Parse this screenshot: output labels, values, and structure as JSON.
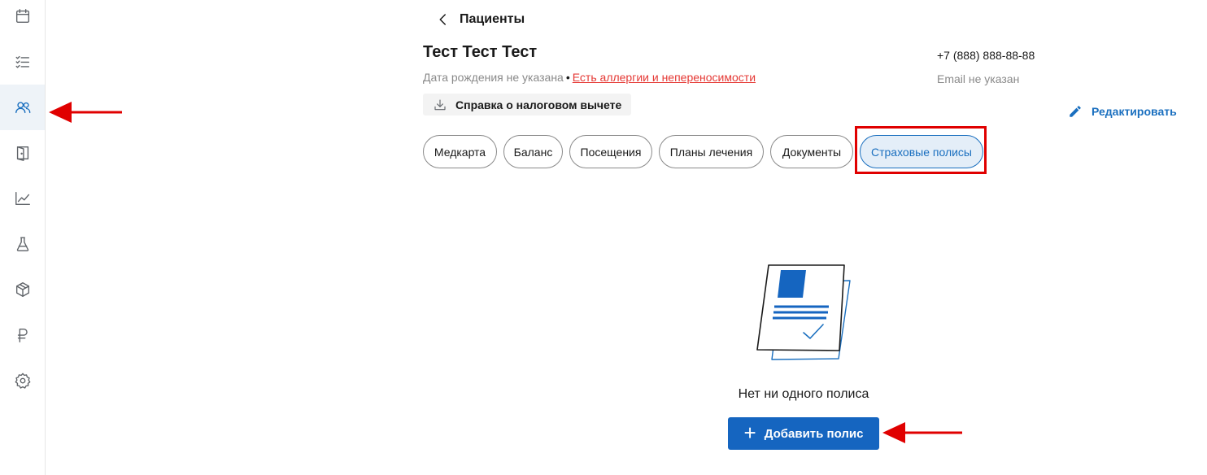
{
  "sidebar": {
    "items": [
      {
        "icon": "calendar-icon",
        "active": false
      },
      {
        "icon": "task-list-icon",
        "active": false
      },
      {
        "icon": "users-icon",
        "active": true
      },
      {
        "icon": "door-icon",
        "active": false
      },
      {
        "icon": "chart-line-icon",
        "active": false
      },
      {
        "icon": "flask-icon",
        "active": false
      },
      {
        "icon": "box-icon",
        "active": false
      },
      {
        "icon": "ruble-icon",
        "active": false
      },
      {
        "icon": "gear-icon",
        "active": false
      }
    ]
  },
  "header": {
    "back_label": "Пациенты",
    "patient_name": "Тест Тест Тест",
    "dob_text": "Дата рождения не указана",
    "separator": "•",
    "allergy_link": "Есть аллергии и непереносимости",
    "tax_button": "Справка о налоговом вычете",
    "phone": "+7 (888) 888-88-88",
    "email": "Email не указан",
    "edit_button": "Редактировать"
  },
  "tabs": [
    {
      "label": "Медкарта",
      "active": false
    },
    {
      "label": "Баланс",
      "active": false
    },
    {
      "label": "Посещения",
      "active": false
    },
    {
      "label": "Планы лечения",
      "active": false
    },
    {
      "label": "Документы",
      "active": false
    },
    {
      "label": "Страховые полисы",
      "active": true
    }
  ],
  "empty_state": {
    "illustration": "insurance-document-icon",
    "message": "Нет ни одного полиса",
    "add_button": "Добавить полис"
  },
  "colors": {
    "accent": "#1565c0",
    "link_red": "#e53935",
    "annotation_red": "#e00000",
    "active_tab_bg": "#e4eef8"
  }
}
